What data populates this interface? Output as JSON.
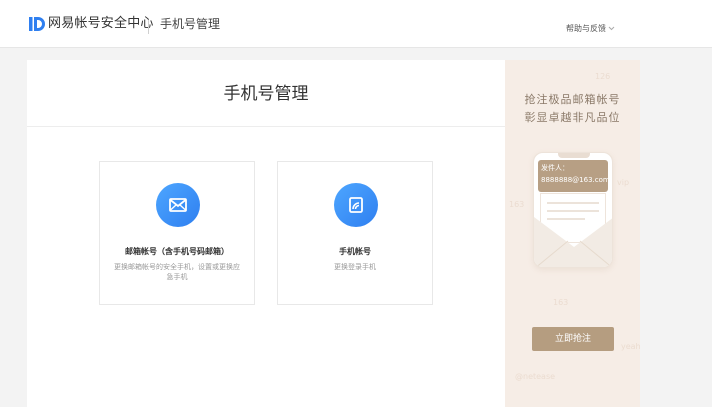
{
  "header": {
    "brand": "网易帐号安全中心",
    "breadcrumb": "手机号管理",
    "help_label": "帮助与反馈"
  },
  "main": {
    "title": "手机号管理",
    "options": [
      {
        "title": "邮箱帐号（含手机号码邮箱）",
        "desc": "更换邮箱帐号的安全手机，设置或更换应急手机"
      },
      {
        "title": "手机帐号",
        "desc": "更换登录手机"
      }
    ]
  },
  "ad": {
    "headline_1": "抢注极品邮箱帐号",
    "headline_2": "彰显卓越非凡品位",
    "sender_label": "发件人：",
    "sender_email": "8888888@163.com",
    "cta_label": "立即抢注"
  },
  "colors": {
    "accent": "#2f7ff0",
    "ad_bg": "#f6ede6",
    "ad_button": "#b59d80"
  },
  "icons": {
    "logo": "netease-id-logo",
    "help_chevron": "chevron-down-icon",
    "email": "envelope-icon",
    "phone": "phone-account-icon"
  }
}
